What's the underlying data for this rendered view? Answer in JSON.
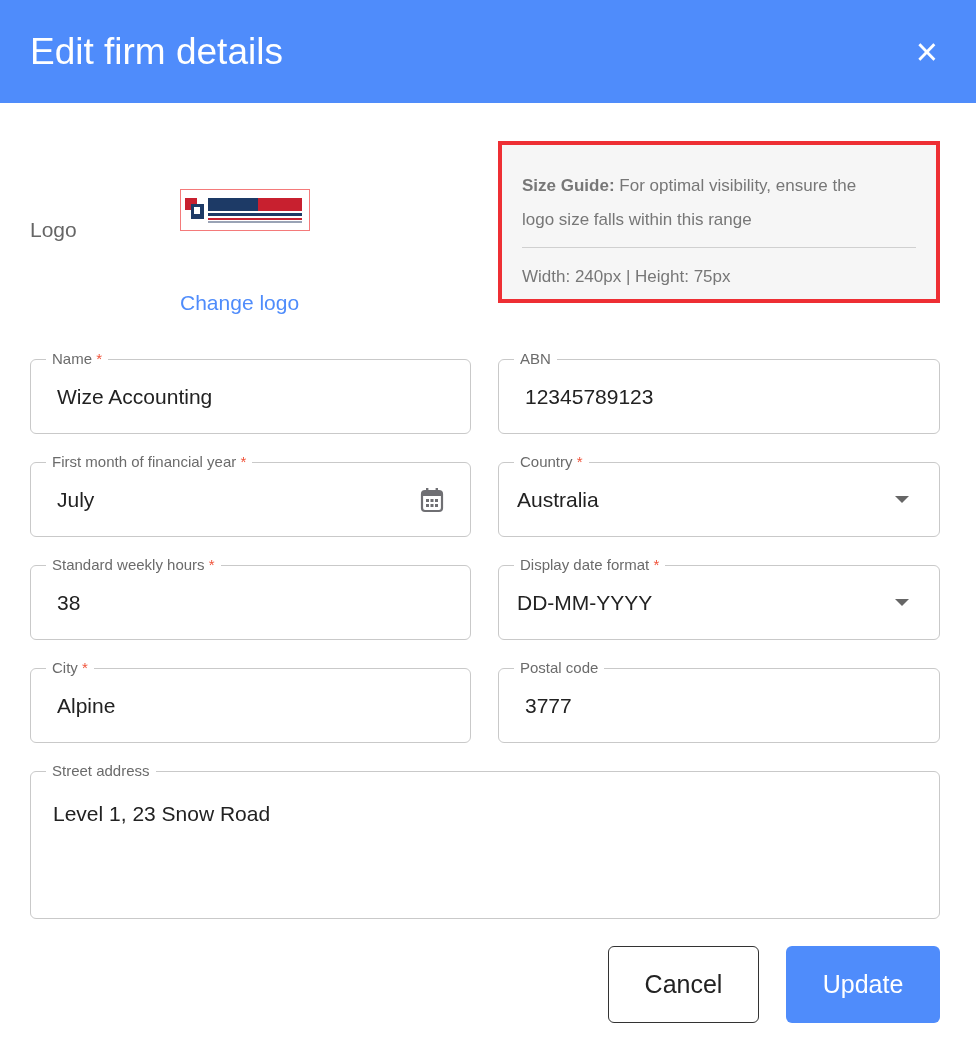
{
  "dialog": {
    "title": "Edit firm details",
    "close": "×"
  },
  "logo": {
    "label": "Logo",
    "change_link": "Change logo"
  },
  "size_guide": {
    "text": "**Size Guide:** For optimal visibility, ensure the logo size falls within this range",
    "dimensions": "Width: 240px | Height: 75px",
    "highlighted": true
  },
  "fields": [
    {
      "label": "Name",
      "required_mark": "*",
      "kind": "text",
      "value": "Wize Accounting"
    },
    {
      "label": "ABN",
      "kind": "text",
      "value": "12345789123"
    },
    {
      "label": "First month of financial year",
      "required_mark": "*",
      "kind": "date",
      "value": "July"
    },
    {
      "label": "Country",
      "required_mark": "*",
      "kind": "select",
      "value": "Australia"
    },
    {
      "label": "Standard weekly hours",
      "required_mark": "*",
      "kind": "text",
      "value": "38"
    },
    {
      "label": "Display date format",
      "required_mark": "*",
      "kind": "select",
      "value": "DD-MM-YYYY"
    },
    {
      "label": "City",
      "required_mark": "*",
      "kind": "text",
      "value": "Alpine"
    },
    {
      "label": "Postal code",
      "kind": "text",
      "value": "3777"
    },
    {
      "label": "Street address",
      "kind": "textarea",
      "value": "Level 1, 23 Snow Road"
    }
  ],
  "buttons": [
    {
      "label": "Cancel",
      "kind": "secondary"
    },
    {
      "label": "Update",
      "kind": "primary"
    }
  ]
}
